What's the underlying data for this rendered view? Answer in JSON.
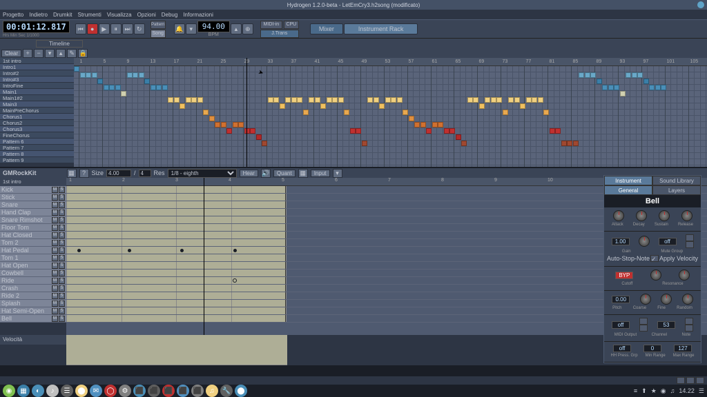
{
  "window": {
    "title": "Hydrogen 1.2.0-beta - LetEmCry3.h2song (modificato)"
  },
  "menu": [
    "Progetto",
    "Indietro",
    "Drumkit",
    "Strumenti",
    "Visualizza",
    "Opzioni",
    "Debug",
    "Informazioni"
  ],
  "transport": {
    "timecode": "00:01:12.817",
    "timecode_labels": "Hrs   Min   Sec   1/1000",
    "mode": "Song",
    "bpm": "94.00",
    "bpm_label": "BPM",
    "jtrans": "J.Trans",
    "midi_in": "MIDI-in",
    "cpu": "CPU",
    "mixer": "Mixer",
    "instrument_rack": "Instrument Rack"
  },
  "song_editor": {
    "timeline": "Timeline",
    "clear": "Clear",
    "patterns": [
      "1st intro",
      "Intro1",
      "Intro#2",
      "Intro#3",
      "IntroFine",
      "Main1",
      "Main1#2",
      "Main3",
      "MainPreChorus",
      "Chorus1",
      "Chorus2",
      "Chorus3",
      "FineChorus",
      "Pattern 6",
      "Pattern 7",
      "Pattern 8",
      "Pattern 9"
    ],
    "playhead_col": 29,
    "ruler_marks": [
      1,
      5,
      9,
      13,
      17,
      21,
      25,
      29,
      33,
      37,
      41,
      45,
      49,
      53,
      57,
      61,
      65,
      69,
      73,
      77,
      81,
      85,
      89,
      93,
      97,
      101,
      105
    ],
    "cells": [
      {
        "r": 0,
        "c": 0,
        "color": "#4a8fb8"
      },
      {
        "r": 1,
        "c": 1,
        "color": "#6aa8c8"
      },
      {
        "r": 1,
        "c": 2,
        "color": "#6aa8c8"
      },
      {
        "r": 1,
        "c": 3,
        "color": "#6aa8c8"
      },
      {
        "r": 1,
        "c": 9,
        "color": "#6aa8c8"
      },
      {
        "r": 1,
        "c": 10,
        "color": "#6aa8c8"
      },
      {
        "r": 1,
        "c": 11,
        "color": "#6aa8c8"
      },
      {
        "r": 1,
        "c": 86,
        "color": "#6aa8c8"
      },
      {
        "r": 1,
        "c": 87,
        "color": "#6aa8c8"
      },
      {
        "r": 1,
        "c": 88,
        "color": "#6aa8c8"
      },
      {
        "r": 1,
        "c": 94,
        "color": "#6aa8c8"
      },
      {
        "r": 1,
        "c": 95,
        "color": "#6aa8c8"
      },
      {
        "r": 1,
        "c": 96,
        "color": "#6aa8c8"
      },
      {
        "r": 2,
        "c": 4,
        "color": "#3a7fa8"
      },
      {
        "r": 2,
        "c": 12,
        "color": "#3a7fa8"
      },
      {
        "r": 2,
        "c": 89,
        "color": "#3a7fa8"
      },
      {
        "r": 2,
        "c": 97,
        "color": "#3a7fa8"
      },
      {
        "r": 3,
        "c": 5,
        "color": "#4a8fb8"
      },
      {
        "r": 3,
        "c": 6,
        "color": "#4a8fb8"
      },
      {
        "r": 3,
        "c": 7,
        "color": "#4a8fb8"
      },
      {
        "r": 3,
        "c": 13,
        "color": "#4a8fb8"
      },
      {
        "r": 3,
        "c": 14,
        "color": "#4a8fb8"
      },
      {
        "r": 3,
        "c": 15,
        "color": "#4a8fb8"
      },
      {
        "r": 3,
        "c": 90,
        "color": "#4a8fb8"
      },
      {
        "r": 3,
        "c": 91,
        "color": "#4a8fb8"
      },
      {
        "r": 3,
        "c": 92,
        "color": "#4a8fb8"
      },
      {
        "r": 3,
        "c": 98,
        "color": "#4a8fb8"
      },
      {
        "r": 3,
        "c": 99,
        "color": "#4a8fb8"
      },
      {
        "r": 3,
        "c": 100,
        "color": "#4a8fb8"
      },
      {
        "r": 4,
        "c": 8,
        "color": "#d0d0b0"
      },
      {
        "r": 4,
        "c": 93,
        "color": "#d0d0b0"
      },
      {
        "r": 5,
        "c": 16,
        "color": "#f0d080"
      },
      {
        "r": 5,
        "c": 17,
        "color": "#f0d080"
      },
      {
        "r": 5,
        "c": 19,
        "color": "#f0d080"
      },
      {
        "r": 5,
        "c": 20,
        "color": "#f0d080"
      },
      {
        "r": 5,
        "c": 21,
        "color": "#f0d080"
      },
      {
        "r": 5,
        "c": 33,
        "color": "#f0d080"
      },
      {
        "r": 5,
        "c": 34,
        "color": "#f0d080"
      },
      {
        "r": 5,
        "c": 36,
        "color": "#f0d080"
      },
      {
        "r": 5,
        "c": 37,
        "color": "#f0d080"
      },
      {
        "r": 5,
        "c": 38,
        "color": "#f0d080"
      },
      {
        "r": 5,
        "c": 40,
        "color": "#f0d080"
      },
      {
        "r": 5,
        "c": 41,
        "color": "#f0d080"
      },
      {
        "r": 5,
        "c": 43,
        "color": "#f0d080"
      },
      {
        "r": 5,
        "c": 44,
        "color": "#f0d080"
      },
      {
        "r": 5,
        "c": 45,
        "color": "#f0d080"
      },
      {
        "r": 5,
        "c": 50,
        "color": "#f0d080"
      },
      {
        "r": 5,
        "c": 51,
        "color": "#f0d080"
      },
      {
        "r": 5,
        "c": 53,
        "color": "#f0d080"
      },
      {
        "r": 5,
        "c": 54,
        "color": "#f0d080"
      },
      {
        "r": 5,
        "c": 55,
        "color": "#f0d080"
      },
      {
        "r": 5,
        "c": 67,
        "color": "#f0d080"
      },
      {
        "r": 5,
        "c": 68,
        "color": "#f0d080"
      },
      {
        "r": 5,
        "c": 70,
        "color": "#f0d080"
      },
      {
        "r": 5,
        "c": 71,
        "color": "#f0d080"
      },
      {
        "r": 5,
        "c": 72,
        "color": "#f0d080"
      },
      {
        "r": 5,
        "c": 74,
        "color": "#f0d080"
      },
      {
        "r": 5,
        "c": 75,
        "color": "#f0d080"
      },
      {
        "r": 5,
        "c": 77,
        "color": "#f0d080"
      },
      {
        "r": 5,
        "c": 78,
        "color": "#f0d080"
      },
      {
        "r": 5,
        "c": 79,
        "color": "#f0d080"
      },
      {
        "r": 6,
        "c": 18,
        "color": "#f0c060"
      },
      {
        "r": 6,
        "c": 35,
        "color": "#f0c060"
      },
      {
        "r": 6,
        "c": 42,
        "color": "#f0c060"
      },
      {
        "r": 6,
        "c": 52,
        "color": "#f0c060"
      },
      {
        "r": 6,
        "c": 69,
        "color": "#f0c060"
      },
      {
        "r": 6,
        "c": 76,
        "color": "#f0c060"
      },
      {
        "r": 7,
        "c": 22,
        "color": "#e8a850"
      },
      {
        "r": 7,
        "c": 39,
        "color": "#e8a850"
      },
      {
        "r": 7,
        "c": 46,
        "color": "#e8a850"
      },
      {
        "r": 7,
        "c": 56,
        "color": "#e8a850"
      },
      {
        "r": 7,
        "c": 73,
        "color": "#e8a850"
      },
      {
        "r": 7,
        "c": 80,
        "color": "#e8a850"
      },
      {
        "r": 8,
        "c": 23,
        "color": "#e09040"
      },
      {
        "r": 8,
        "c": 57,
        "color": "#e09040"
      },
      {
        "r": 9,
        "c": 24,
        "color": "#d07030"
      },
      {
        "r": 9,
        "c": 25,
        "color": "#d07030"
      },
      {
        "r": 9,
        "c": 27,
        "color": "#d07030"
      },
      {
        "r": 9,
        "c": 28,
        "color": "#d07030"
      },
      {
        "r": 9,
        "c": 58,
        "color": "#d07030"
      },
      {
        "r": 9,
        "c": 59,
        "color": "#d07030"
      },
      {
        "r": 9,
        "c": 61,
        "color": "#d07030"
      },
      {
        "r": 9,
        "c": 62,
        "color": "#d07030"
      },
      {
        "r": 10,
        "c": 26,
        "color": "#c03030"
      },
      {
        "r": 10,
        "c": 29,
        "color": "#c03030"
      },
      {
        "r": 10,
        "c": 30,
        "color": "#c03030"
      },
      {
        "r": 10,
        "c": 47,
        "color": "#c03030"
      },
      {
        "r": 10,
        "c": 48,
        "color": "#c03030"
      },
      {
        "r": 10,
        "c": 60,
        "color": "#c03030"
      },
      {
        "r": 10,
        "c": 63,
        "color": "#c03030"
      },
      {
        "r": 10,
        "c": 64,
        "color": "#c03030"
      },
      {
        "r": 10,
        "c": 81,
        "color": "#c03030"
      },
      {
        "r": 10,
        "c": 82,
        "color": "#c03030"
      },
      {
        "r": 11,
        "c": 31,
        "color": "#b02828"
      },
      {
        "r": 11,
        "c": 65,
        "color": "#b02828"
      },
      {
        "r": 12,
        "c": 32,
        "color": "#a04830"
      },
      {
        "r": 12,
        "c": 49,
        "color": "#a04830"
      },
      {
        "r": 12,
        "c": 66,
        "color": "#a04830"
      },
      {
        "r": 12,
        "c": 83,
        "color": "#a04830"
      },
      {
        "r": 12,
        "c": 84,
        "color": "#a04830"
      },
      {
        "r": 12,
        "c": 85,
        "color": "#a04830"
      }
    ]
  },
  "pattern_editor": {
    "kit": "GMRockKit",
    "size_label": "Size",
    "size_value": "4.00",
    "size_beats": "4",
    "res_label": "Res",
    "res_value": "1/8 - eighth",
    "hear": "Hear",
    "quant": "Quant",
    "input": "Input",
    "current_pattern": "1st intro",
    "ruler_marks": [
      "1",
      "2",
      "3",
      "4",
      "5",
      "6",
      "7",
      "8",
      "9",
      "10"
    ],
    "instruments": [
      "Kick",
      "Stick",
      "Snare",
      "Hand Clap",
      "Snare Rimshot",
      "Floor Tom",
      "Hat Closed",
      "Tom 2",
      "Hat Pedal",
      "Tom 1",
      "Hat Open",
      "Cowbell",
      "Ride",
      "Crash",
      "Ride 2",
      "Splash",
      "Hat Semi-Open",
      "Bell"
    ],
    "notes": [
      {
        "inst": 8,
        "pos": 0.05
      },
      {
        "inst": 8,
        "pos": 0.28
      },
      {
        "inst": 8,
        "pos": 0.52
      },
      {
        "inst": 8,
        "pos": 0.76
      }
    ],
    "ring_note": {
      "inst": 12,
      "pos": 0.76
    },
    "velocity_label": "Velocità"
  },
  "instrument_panel": {
    "tabs": {
      "instrument": "Instrument",
      "sound_library": "Sound Library",
      "general": "General",
      "layers": "Layers"
    },
    "name": "Bell",
    "adsr_labels": [
      "Attack",
      "Decay",
      "Sustain",
      "Release"
    ],
    "gain": "1.00",
    "gain_label": "Gain",
    "mute_group": "off",
    "mute_group_label": "Mute Group",
    "auto_stop": "Auto-Stop-Note",
    "apply_velocity": "Apply Velocity",
    "byp": "BYP",
    "filter_labels": [
      "Cutoff",
      "Resonance"
    ],
    "pitch": "0.00",
    "pitch_labels": [
      "Pitch",
      "Coarse",
      "Fine",
      "Random"
    ],
    "midi_out": "off",
    "midi_note": "53",
    "midi_labels": [
      "MIDI Output",
      "Channel",
      "Note"
    ],
    "hh_group": "off",
    "min_range": "0",
    "max_range": "127",
    "hh_labels": [
      "HH Press. Grp",
      "Min Range",
      "Max Range"
    ]
  },
  "taskbar": {
    "time": "14.22",
    "icons_left": [
      "◉",
      "▦",
      "◐",
      "♪",
      "☰",
      "⬤",
      "✉",
      "◯",
      "⚙",
      "⬛",
      "⬛",
      "⬛",
      "⬛",
      "⬛",
      "♫",
      "🔧",
      "⬤"
    ],
    "colors": [
      "#7fc050",
      "#3a7fa8",
      "#4a8fb8",
      "#c0c0c0",
      "#606060",
      "#f0d080",
      "#5090c0",
      "#c03030",
      "#808080",
      "#4a8fb8",
      "#606060",
      "#c03030",
      "#5090c0",
      "#808080",
      "#f0d080",
      "#606060",
      "#4a8fb8"
    ]
  }
}
